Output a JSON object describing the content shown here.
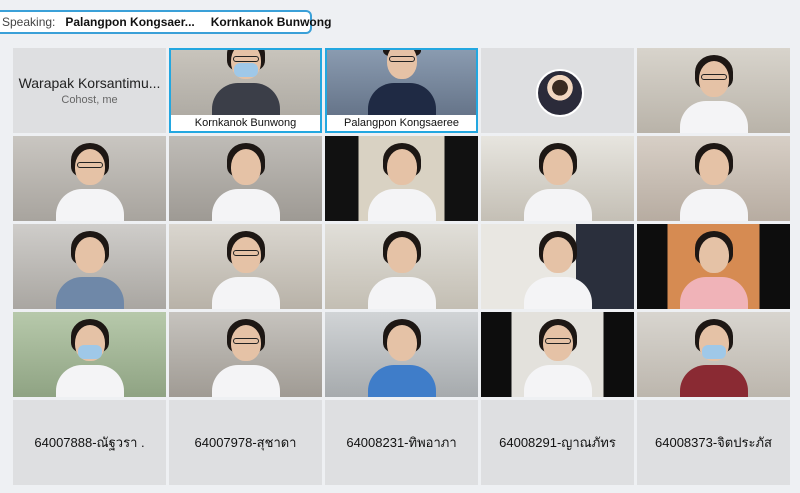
{
  "speaking_bar": {
    "label": "Speaking:",
    "speakers": [
      "Palangpon Kongsaer...",
      "Kornkanok Bunwong"
    ]
  },
  "tiles": [
    {
      "type": "name",
      "name": "Warapak Korsantimu...",
      "role": "Cohost, me"
    },
    {
      "type": "video",
      "caption": "Kornkanok Bunwong",
      "active": true
    },
    {
      "type": "video",
      "caption": "Palangpon Kongsaeree",
      "active": true
    },
    {
      "type": "avatar"
    },
    {
      "type": "video"
    },
    {
      "type": "video"
    },
    {
      "type": "video"
    },
    {
      "type": "video"
    },
    {
      "type": "video"
    },
    {
      "type": "video"
    },
    {
      "type": "video"
    },
    {
      "type": "video"
    },
    {
      "type": "video"
    },
    {
      "type": "video"
    },
    {
      "type": "video"
    },
    {
      "type": "video"
    },
    {
      "type": "video"
    },
    {
      "type": "video"
    },
    {
      "type": "video"
    },
    {
      "type": "video"
    },
    {
      "type": "label",
      "name": "64007888-ณัฐวรา ."
    },
    {
      "type": "label",
      "name": "64007978-สุชาดา"
    },
    {
      "type": "label",
      "name": "64008231-ทิพอาภา"
    },
    {
      "type": "label",
      "name": "64008291-ญาณภัทร"
    },
    {
      "type": "label",
      "name": "64008373-จิตประภัส"
    }
  ],
  "colors": {
    "active_border": "#23a7e0",
    "name_tile_bg": "#dedfe1",
    "speaking_border": "#3aa0d8"
  }
}
